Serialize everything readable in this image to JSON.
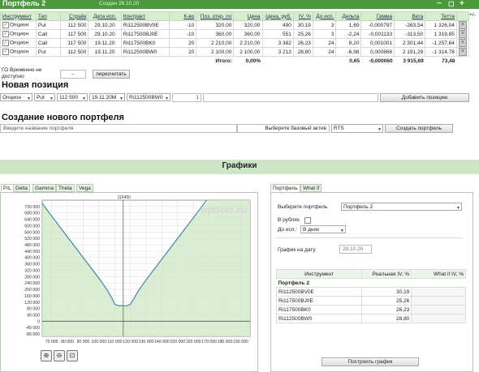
{
  "window": {
    "title": "Портфель 2",
    "created": "Создан 26.10.20",
    "btn_min": "−",
    "btn_max": "▢",
    "btn_add": "+",
    "btn_more": "+/-"
  },
  "table": {
    "headers": [
      "Инструмент",
      "Тип",
      "Страйк",
      "Дата исп.",
      "Контракт",
      "К-во",
      "Поз. откр. по",
      "Цена",
      "Цена, руб.",
      "IV, %",
      "До исп.",
      "Дельта",
      "Гамма",
      "Вега",
      "Тетта"
    ],
    "rows": [
      [
        "Опцион",
        "Put",
        "112 500",
        "29.10.20",
        "Ri112500BV0E",
        "-10",
        "320,00",
        "320,00",
        "490",
        "30,19",
        "3",
        "1,69",
        "-0,000797",
        "-263,54",
        "1 326,04"
      ],
      [
        "Опцион",
        "Call",
        "117 500",
        "29.10.20",
        "Ri117500BJ0E",
        "-10",
        "360,00",
        "360,00",
        "551",
        "25,26",
        "3",
        "-2,24",
        "-0,001133",
        "-313,50",
        "1 319,85"
      ],
      [
        "Опцион",
        "Call",
        "117 500",
        "19.11.20",
        "Ri117500BK0",
        "20",
        "2 210,00",
        "2 210,00",
        "3 382",
        "26,23",
        "24",
        "8,20",
        "0,001001",
        "2 301,44",
        "-1 257,64"
      ],
      [
        "Опцион",
        "Put",
        "112 500",
        "19.11.20",
        "Ri112500BW0",
        "20",
        "2 100,00",
        "2 100,00",
        "3 213",
        "28,80",
        "24",
        "-6,98",
        "0,000868",
        "2 191,29",
        "-1 314,78"
      ]
    ],
    "total_label": "Итого:",
    "total_pct": "0,00%",
    "total_delta": "0,65",
    "total_gamma": "-0,000060",
    "total_vega": "3 915,69",
    "total_theta": "73,48"
  },
  "go": {
    "label": "ГО Временно не доступно",
    "value": "--",
    "recalc_button": "пересчитать"
  },
  "new_position": {
    "heading": "Новая позиция",
    "instrument": "Опцион",
    "type": "Put",
    "strike": "112 500",
    "date": "19.11.20M",
    "contract": "Ri112500BW0",
    "qty": "1",
    "price": "",
    "add_button": "Добавить позицию"
  },
  "new_portfolio": {
    "heading": "Создание нового портфеля",
    "name_placeholder": "Введите название портфеля",
    "base_label": "Выберите базовый актив",
    "base_value": "RTS",
    "create_button": "Создать портфель"
  },
  "graphs": {
    "heading": "Графики",
    "left_tabs": [
      "P/L",
      "Delta",
      "Gamma",
      "Theta",
      "Vega"
    ],
    "right_tabs": [
      "Портфель",
      "What if"
    ],
    "watermark": "option.ru",
    "marker_label": "115450"
  },
  "chart_data": {
    "type": "line",
    "x_ticks": [
      "70 000",
      "80 000",
      "90 000",
      "100 000",
      "110 000",
      "120 000",
      "130 000",
      "140 000",
      "150 000",
      "160 000",
      "170 000",
      "180 000",
      "190 000"
    ],
    "y_ticks": [
      "-80 000",
      "-40 000",
      "0",
      "40 000",
      "80 000",
      "120 000",
      "160 000",
      "200 000",
      "240 000",
      "280 000",
      "320 000",
      "360 000",
      "400 000",
      "440 000",
      "480 000",
      "520 000",
      "560 000",
      "600 000",
      "640 000",
      "680 000",
      "720 000"
    ],
    "xlim": [
      64000,
      196000
    ],
    "ylim": [
      -95000,
      760000
    ],
    "marker_x": 115450,
    "series": [
      {
        "x": [
          64000,
          70000,
          80000,
          90000,
          100000,
          105000,
          108000,
          110000,
          112500,
          115000,
          117500,
          120000,
          122000,
          125000,
          130000,
          140000,
          150000,
          160000,
          170000,
          180000,
          190000,
          196000
        ],
        "y": [
          740000,
          660000,
          530000,
          400000,
          270000,
          200000,
          150000,
          108000,
          97000,
          98000,
          96000,
          106000,
          138000,
          190000,
          260000,
          390000,
          520000,
          650000,
          780000,
          910000,
          1040000,
          1120000
        ]
      }
    ],
    "xlabel": "",
    "ylabel": "",
    "grid": true
  },
  "what_if": {
    "portfolio_label": "Выберите портфель",
    "portfolio_value": "Портфель 2",
    "rub_label": "В рублях",
    "expiry_label": "До исп.:",
    "expiry_value": "В днях",
    "date_label": "График на дату",
    "date_value": "28.10.20",
    "col_instrument": "Инструмент",
    "col_real_iv": "Реальная IV, %",
    "col_whatif_iv": "What if IV, %",
    "group": "Портфель 2",
    "rows": [
      [
        "Ri112500BV0E",
        "30,19"
      ],
      [
        "Ri117500BJ0E",
        "25,26"
      ],
      [
        "Ri117500BK0",
        "26,23"
      ],
      [
        "Ri112500BW0",
        "28,80"
      ]
    ],
    "build_button": "Построить график"
  }
}
